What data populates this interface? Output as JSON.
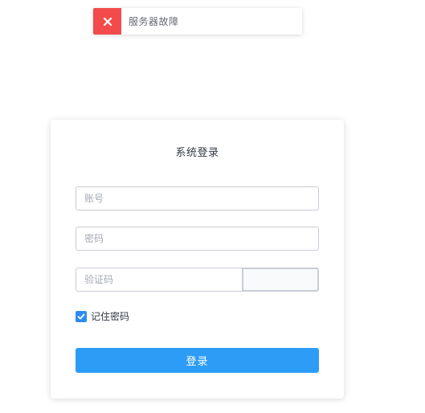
{
  "toast": {
    "message": "服务器故障",
    "icon": "close-icon",
    "color": "#f34b4b"
  },
  "login": {
    "title": "系统登录",
    "account_placeholder": "账号",
    "account_value": "",
    "password_placeholder": "密码",
    "password_value": "",
    "captcha_placeholder": "验证码",
    "captcha_value": "",
    "remember_label": "记住密码",
    "remember_checked": true,
    "submit_label": "登录",
    "accent_color": "#2d9cf6"
  }
}
